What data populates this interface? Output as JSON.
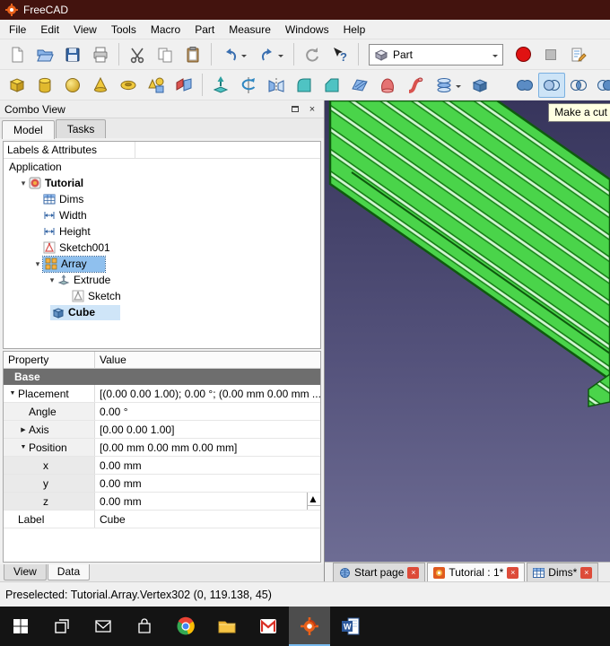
{
  "titlebar": {
    "title": "FreeCAD"
  },
  "menubar": {
    "items": [
      "File",
      "Edit",
      "View",
      "Tools",
      "Macro",
      "Part",
      "Measure",
      "Windows",
      "Help"
    ]
  },
  "toolbar": {
    "workbench_selected": "Part"
  },
  "combo_view": {
    "title": "Combo View",
    "tab_model": "Model",
    "tab_tasks": "Tasks",
    "tree_header": "Labels & Attributes",
    "tree": {
      "application": "Application",
      "tutorial": "Tutorial",
      "dims": "Dims",
      "width": "Width",
      "height": "Height",
      "sketch001": "Sketch001",
      "array": "Array",
      "extrude": "Extrude",
      "sketch": "Sketch",
      "cube": "Cube"
    },
    "bottom_tab_view": "View",
    "bottom_tab_data": "Data"
  },
  "properties": {
    "col_property": "Property",
    "col_value": "Value",
    "group_base": "Base",
    "rows": [
      {
        "name": "Placement",
        "value": "[(0.00 0.00 1.00); 0.00 °; (0.00 mm 0.00 mm ..."
      },
      {
        "name": "Angle",
        "value": "0.00 °"
      },
      {
        "name": "Axis",
        "value": "[0.00 0.00 1.00]"
      },
      {
        "name": "Position",
        "value": "[0.00 mm  0.00 mm  0.00 mm]"
      },
      {
        "name": "x",
        "value": "0.00 mm"
      },
      {
        "name": "y",
        "value": "0.00 mm"
      },
      {
        "name": "z",
        "value": "0.00 mm"
      },
      {
        "name": "Label",
        "value": "Cube"
      }
    ]
  },
  "viewport": {
    "tooltip": "Make a cut",
    "tabs": [
      {
        "label": "Start page"
      },
      {
        "label": "Tutorial : 1*"
      },
      {
        "label": "Dims*"
      }
    ]
  },
  "statusbar": {
    "text": "Preselected: Tutorial.Array.Vertex302 (0, 119.138, 45)"
  },
  "icons": {
    "expander_open": "▼",
    "expander_closed": "▶",
    "tree_expander_open": "▾",
    "close": "×",
    "spin_up": "▲",
    "spin_down": "▼"
  }
}
